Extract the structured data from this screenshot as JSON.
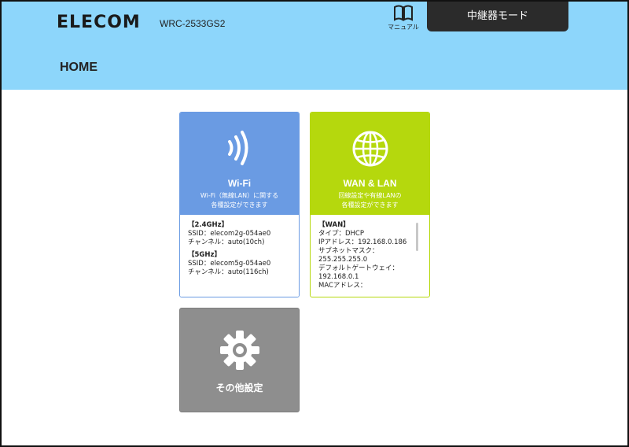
{
  "header": {
    "logo": "ELECOM",
    "model": "WRC-2533GS2",
    "manual_label": "マニュアル",
    "mode_button": "中継器モード",
    "page_title": "HOME"
  },
  "colors": {
    "header_bg": "#8dd6fb",
    "wifi": "#6a9be3",
    "wan": "#b5d80d",
    "other": "#8e8e8e"
  },
  "cards": {
    "wifi": {
      "icon": "wifi-icon",
      "title": "Wi-Fi",
      "desc1": "Wi-Fi（無線LAN）に関する",
      "desc2": "各種設定ができます",
      "sec1": "【2.4GHz】",
      "ssid1": "SSID：elecom2g-054ae0",
      "ch1": "チャンネル：auto(10ch)",
      "sec2": "【5GHz】",
      "ssid2": "SSID：elecom5g-054ae0",
      "ch2": "チャンネル：auto(116ch)"
    },
    "wan": {
      "icon": "globe-icon",
      "title": "WAN & LAN",
      "desc1": "回線設定や有線LANの",
      "desc2": "各種設定ができます",
      "sec": "【WAN】",
      "type": "タイプ：DHCP",
      "ip": "IPアドレス：192.168.0.186",
      "subnet_label": "サブネットマスク：",
      "subnet": "255.255.255.0",
      "gw_label": "デフォルトゲートウェイ：",
      "gw": "192.168.0.1",
      "mac_label": "MACアドレス："
    },
    "other": {
      "icon": "gear-icon",
      "title": "その他設定"
    }
  }
}
